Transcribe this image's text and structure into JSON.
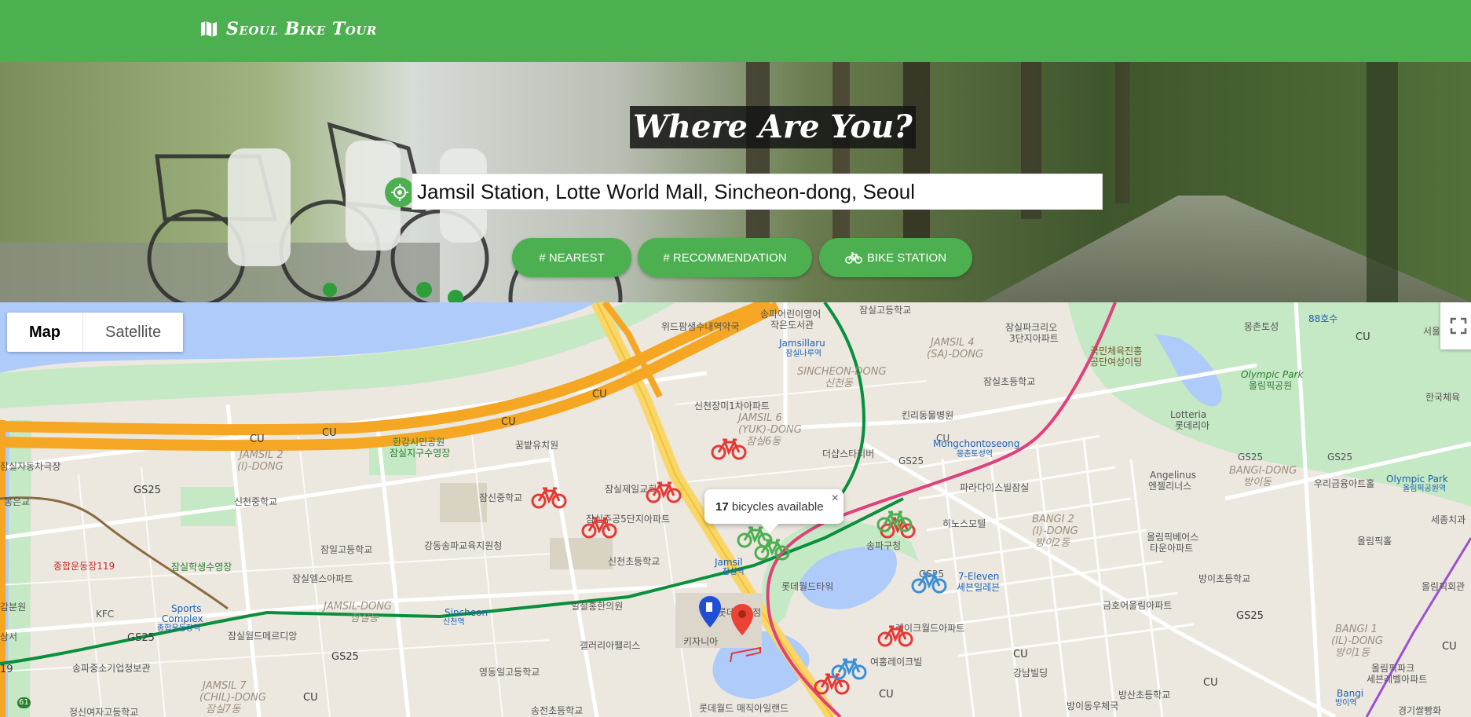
{
  "header": {
    "brand_icon": "map-icon",
    "brand_title": "Seoul Bike Tour"
  },
  "hero": {
    "title": "Where Are You?",
    "search": {
      "value": "Jamsil Station, Lotte World Mall, Sincheon-dong, Seoul",
      "icon": "location-crosshair-icon"
    },
    "buttons": [
      {
        "label": "# NEAREST"
      },
      {
        "label": "# RECOMMENDATION"
      },
      {
        "label": "BIKE STATION",
        "icon": "bicycle-icon"
      }
    ]
  },
  "map": {
    "type_control": {
      "map": "Map",
      "satellite": "Satellite",
      "selected": "Map"
    },
    "fullscreen_icon": "fullscreen-icon",
    "info_window": {
      "count": "17",
      "text": "bicycles available",
      "close": "×"
    },
    "colors": {
      "water": "#aecbfa",
      "park": "#c5e8c5",
      "expressway": "#f5a623",
      "subway_line2": "#0a8f3c",
      "subway_line8": "#e0407b",
      "bike_available": "#4caf50",
      "bike_unavailable": "#e53935",
      "bike_blue": "#3b8fd6",
      "marker_current": "#ea4335",
      "marker_station": "#1e4fd6"
    },
    "labels": {
      "songpa_children_library": "송파어린이영어",
      "songpa_children_library2": "작은도서관",
      "jamsil_elem": "잠실고등학교",
      "widepam": "위드팜생수내역약국",
      "jamsillaru": "Jamsillaru",
      "jamsillaru_kr": "잠실나루역",
      "sincheon_dong": "SINCHEON-DONG",
      "sincheon_dong_kr": "신천동",
      "jamsil4": "JAMSIL 4",
      "jamsil4b": "(SA)-DONG",
      "jamsil_park": "잠실파크리오",
      "jamsil_park2": "3단지아파트",
      "olympic_center": "국민체육진흥",
      "olympic_center2": "공단여성이팅",
      "olympic_park": "Olympic Park",
      "olympic_park_kr": "올림픽공원",
      "mongchontoseong": "Mongchontoseong",
      "mongchontoseong_kr": "몽촌토성역",
      "korea_sports": "한국체육",
      "jamsil_cho": "잠실초등학교",
      "killer_hospital": "킨리동물병원",
      "lotteria": "Lotteria",
      "lotteria_kr": "롯데리아",
      "sincheon_apt": "신천장미1차아파트",
      "jamsil6": "JAMSIL 6",
      "jamsil6b": "(YUK)-DONG",
      "jamsil6_kr": "잠실6동",
      "the_sky": "더샵스타리버",
      "hanriver_park": "한강시민공원",
      "hanriver_park2": "잠실지구수영장",
      "kkumbat": "꿈밭유치원",
      "jamsil2": "JAMSIL 2",
      "jamsil2b": "(I)-DONG",
      "jamsil_car": "잠실자동차극장",
      "bongeungyo": "봉은교",
      "angelinus": "Angelinus",
      "angelinus_kr": "엔젤리너스",
      "bangi_dong": "BANGI-DONG",
      "bangi_dong_kr": "방이동",
      "woori_bank": "우리금융아트홀",
      "olympic_park_stn": "Olympic Park",
      "olympic_park_stn_kr": "올림픽공원역",
      "sejong": "세종치과",
      "jamsil_jeil": "잠실제일교회",
      "jamsil_ju5": "잠실주공5단지아파트",
      "paradise": "파라다이스빌잠실",
      "jamsin_middle": "잠신중학교",
      "sincheon_middle": "신천중학교",
      "heenus": "히노스모텔",
      "bangi2": "BANGI 2",
      "bangi2b": "(I)-DONG",
      "bangi2_kr": "방이2동",
      "olympic_beer": "올림픽베어스",
      "olympic_beer2": "타운아파트",
      "olympic_pool": "올림픽홀",
      "gangdong_edu": "강동송파교육지원청",
      "sincheon_cho": "신천초등학교",
      "songpa_gu": "송파구청",
      "jamsil_go": "잠일고등학교",
      "jamsil_els": "잠실엘스아파트",
      "jamsil_haksang": "잠실학생수영장",
      "jonghap": "종합운동장119",
      "jamsil_stn": "Jamsil",
      "jamsil_stn_kr": "잠실역",
      "lotte_tower": "롯데월드타워",
      "seven_eleven": "7-Eleven",
      "seven_eleven_kr": "세븐일레븐",
      "bangi_cho": "방이초등학교",
      "gumho": "금호어울림아파트",
      "olympic_park_apt": "올림픽파크",
      "olympic_park_apt2": "세븐레벨아파트",
      "olympic_hall": "올림픽회관",
      "jamsil_dong": "JAMSIL-DONG",
      "jamsil_dong_kr": "잠실동",
      "sincheon_stn": "Sincheon",
      "sincheon_stn_kr": "신천역",
      "ilcheol": "일철홍한의원",
      "sports_complex": "Sports",
      "sports_complex2": "Complex",
      "sports_complex_kr": "종합운동장역",
      "kfc": "KFC",
      "jamsil_world": "잠실월드메르디앙",
      "sumppa": "송파중소기업정보관",
      "galleria": "갤러리아팰리스",
      "kidzania": "키자니아",
      "lotte_shop": "롯데백화점",
      "lake_apt": "레이크월드아파트",
      "yeoung_lake": "여홍레이크빌",
      "gangnam_bldg": "강남빌딩",
      "bangi1": "BANGI 1",
      "bangi1b": "(IL)-DONG",
      "bangi1_kr": "방이1동",
      "bangsan": "방산초등학교",
      "bangi_post": "방이동우체국",
      "bangi_stn": "Bangi",
      "bangi_stn_kr": "방이역",
      "gyeonggi": "경기쌀빵화",
      "jamsil7": "JAMSIL 7",
      "jamsil7b": "(CHIL)-DONG",
      "jamsil7_kr": "잠실7동",
      "youngdong_il": "영동일고등학교",
      "songjeon": "송전초등학교",
      "lotte_magic": "롯데월드 매직아일랜드",
      "jeongsin": "정신여자고등학교",
      "gangbun": "감분원",
      "sangseo": "상서",
      "cu": "CU",
      "gs25": "GS25",
      "route_61": "61",
      "route_119": "19",
      "hwaseong": "88호수",
      "mongchon_to": "몽촌토성",
      "seoul_church": "서울"
    }
  }
}
